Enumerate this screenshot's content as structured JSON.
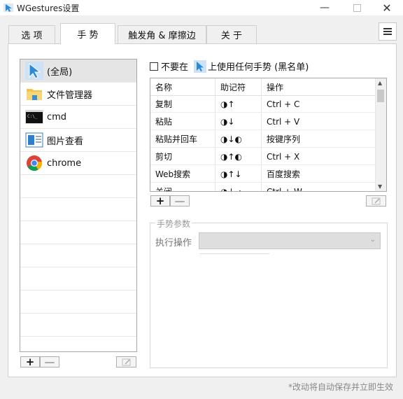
{
  "window": {
    "title": "WGestures设置",
    "min_glyph": "—",
    "close_glyph": "✕"
  },
  "tabs": [
    {
      "label": "选 项"
    },
    {
      "label": "手 势"
    },
    {
      "label": "触发角 & 摩擦边"
    },
    {
      "label": "关 于"
    }
  ],
  "apps": [
    {
      "label": "(全局)",
      "icon": "cursor-icon",
      "selected": true
    },
    {
      "label": "文件管理器",
      "icon": "folder-icon"
    },
    {
      "label": "cmd",
      "icon": "terminal-icon"
    },
    {
      "label": "图片查看",
      "icon": "image-viewer-icon"
    },
    {
      "label": "chrome",
      "icon": "chrome-icon"
    }
  ],
  "app_buttons": {
    "add": "+",
    "remove": "—"
  },
  "blacklist": {
    "prefix": "不要在",
    "suffix": "上使用任何手势 (黑名单)",
    "checked": false
  },
  "gestures": {
    "columns": [
      "名称",
      "助记符",
      "操作"
    ],
    "rows": [
      {
        "name": "复制",
        "mnemonic": "◑↑",
        "action": "Ctrl + C"
      },
      {
        "name": "粘贴",
        "mnemonic": "◑↓",
        "action": "Ctrl + V"
      },
      {
        "name": "粘贴并回车",
        "mnemonic": "◑↓◐",
        "action": "按键序列"
      },
      {
        "name": "剪切",
        "mnemonic": "◑↑◐",
        "action": "Ctrl + X"
      },
      {
        "name": "Web搜索",
        "mnemonic": "◑↑↓",
        "action": "百度搜索"
      },
      {
        "name": "关闭",
        "mnemonic": "◑↓→",
        "action": "Ctrl + W"
      }
    ]
  },
  "gesture_buttons": {
    "add": "+",
    "remove": "—"
  },
  "params": {
    "legend": "手势参数",
    "exec_label": "执行操作",
    "exec_value": ""
  },
  "footer": "*改动将自动保存并立即生效",
  "colors": {
    "accent_blue": "#2a8ad8",
    "folder_yellow": "#f2c34b"
  }
}
